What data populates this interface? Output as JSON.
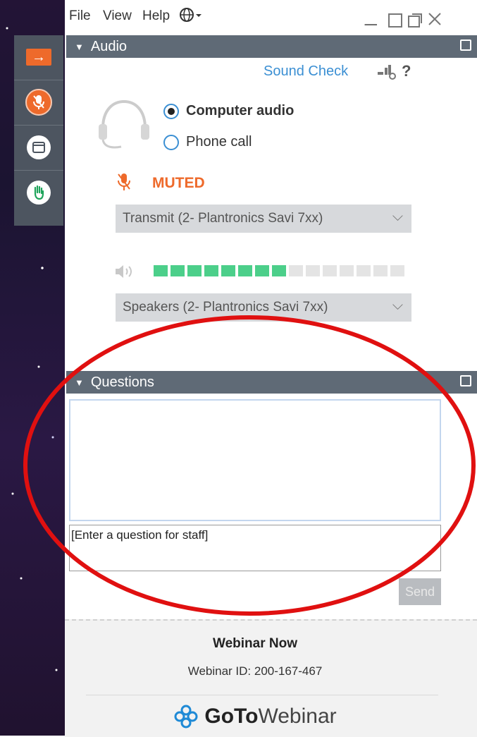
{
  "menu": {
    "file": "File",
    "view": "View",
    "help": "Help"
  },
  "sidebar": {
    "items": [
      "expand-arrow",
      "microphone",
      "window",
      "raise-hand"
    ]
  },
  "audio": {
    "header": "Audio",
    "sound_check": "Sound Check",
    "help_glyph": "?",
    "options": {
      "computer": "Computer audio",
      "phone": "Phone call"
    },
    "selected": "Computer audio",
    "muted_label": "MUTED",
    "mic_device": "Transmit (2- Plantronics Savi 7xx)",
    "speaker_device": "Speakers (2- Plantronics Savi 7xx)",
    "level": {
      "active_segments": 8,
      "total_segments": 15
    }
  },
  "questions": {
    "header": "Questions",
    "input_placeholder": "[Enter a question for staff]",
    "send_label": "Send"
  },
  "footer": {
    "title": "Webinar Now",
    "webinar_id": "Webinar ID: 200-167-467",
    "logo_bold": "GoTo",
    "logo_rest": "Webinar"
  },
  "colors": {
    "accent_orange": "#ee6a2b",
    "link_blue": "#3b8fd3",
    "header_gray": "#5f6a76",
    "level_green": "#4ccf8a",
    "annotation_red": "#e01010"
  }
}
